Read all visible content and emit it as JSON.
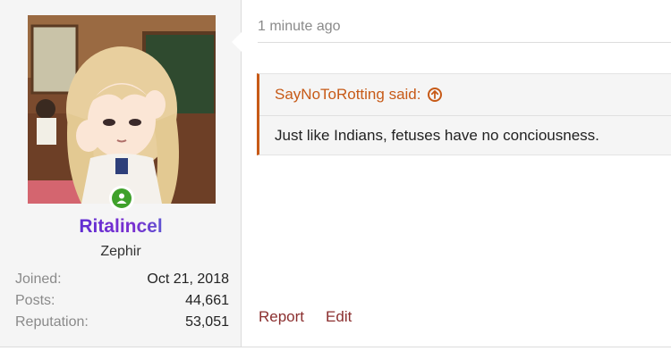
{
  "post": {
    "timestamp": "1 minute ago",
    "quote": {
      "author_label": "SayNoToRotting said:",
      "icon": "arrow-up-circle-icon",
      "text": "Just like Indians, fetuses have no conciousness."
    },
    "actions": {
      "report": "Report",
      "edit": "Edit"
    }
  },
  "user": {
    "username": "Ritalincel",
    "title": "Zephir",
    "online_icon": "user-online-icon",
    "stats": [
      {
        "label": "Joined:",
        "value": "Oct 21, 2018"
      },
      {
        "label": "Posts:",
        "value": "44,661"
      },
      {
        "label": "Reputation:",
        "value": "53,051"
      }
    ]
  },
  "colors": {
    "accent": "#c75a17",
    "link": "#8b2f2f",
    "online": "#3fa12b",
    "username_gradient": [
      "#3c2bd6",
      "#7a2fd0",
      "#18b7d6"
    ]
  }
}
